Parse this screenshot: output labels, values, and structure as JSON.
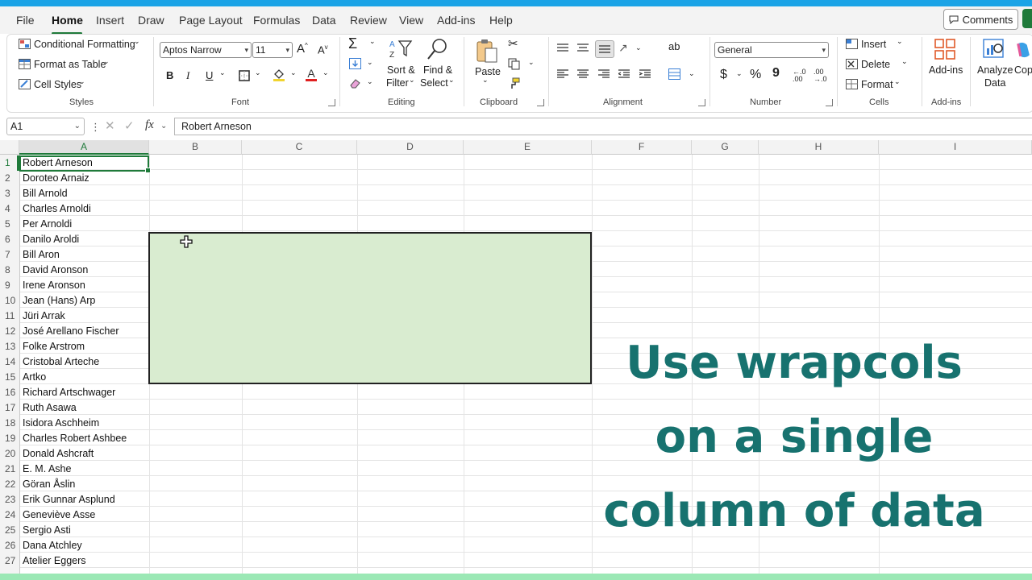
{
  "menu": {
    "tabs": [
      {
        "label": "File"
      },
      {
        "label": "Home"
      },
      {
        "label": "Insert"
      },
      {
        "label": "Draw"
      },
      {
        "label": "Page Layout"
      },
      {
        "label": "Formulas"
      },
      {
        "label": "Data"
      },
      {
        "label": "Review"
      },
      {
        "label": "View"
      },
      {
        "label": "Add-ins"
      },
      {
        "label": "Help"
      }
    ],
    "comments_label": "Comments"
  },
  "ribbon": {
    "styles": {
      "conditional_formatting": "Conditional Formatting",
      "format_as_table": "Format as Table",
      "cell_styles": "Cell Styles",
      "label": "Styles"
    },
    "font": {
      "font_name": "Aptos Narrow",
      "font_size": "11",
      "bold": "B",
      "italic": "I",
      "underline": "U",
      "grow": "A",
      "shrink": "A",
      "font_color_glyph": "A",
      "label": "Font"
    },
    "editing": {
      "sort_filter_1": "Sort &",
      "sort_filter_2": "Filter",
      "find_select_1": "Find &",
      "find_select_2": "Select",
      "label": "Editing"
    },
    "clipboard": {
      "paste": "Paste",
      "label": "Clipboard"
    },
    "alignment": {
      "label": "Alignment"
    },
    "number": {
      "format": "General",
      "label": "Number",
      "currency": "$",
      "percent": "%",
      "comma": "9"
    },
    "cells": {
      "insert": "Insert",
      "delete": "Delete",
      "format": "Format",
      "label": "Cells"
    },
    "addins": {
      "addins": "Add-ins",
      "label": "Add-ins"
    },
    "analyze": {
      "line1": "Analyze",
      "line2": "Data",
      "copilot": "Cop"
    }
  },
  "formula_bar": {
    "name_box": "A1",
    "fx": "fx",
    "content": "Robert Arneson"
  },
  "columns": [
    "A",
    "B",
    "C",
    "D",
    "E",
    "F",
    "G",
    "H",
    "I"
  ],
  "rows": [
    {
      "num": "1",
      "a": "Robert Arneson"
    },
    {
      "num": "2",
      "a": "Doroteo Arnaiz"
    },
    {
      "num": "3",
      "a": "Bill Arnold"
    },
    {
      "num": "4",
      "a": "Charles Arnoldi"
    },
    {
      "num": "5",
      "a": "Per Arnoldi"
    },
    {
      "num": "6",
      "a": "Danilo Aroldi"
    },
    {
      "num": "7",
      "a": "Bill Aron"
    },
    {
      "num": "8",
      "a": "David Aronson"
    },
    {
      "num": "9",
      "a": "Irene Aronson"
    },
    {
      "num": "10",
      "a": "Jean (Hans) Arp"
    },
    {
      "num": "11",
      "a": "Jüri Arrak"
    },
    {
      "num": "12",
      "a": "José Arellano Fischer"
    },
    {
      "num": "13",
      "a": "Folke Arstrom"
    },
    {
      "num": "14",
      "a": "Cristobal Arteche"
    },
    {
      "num": "15",
      "a": "Artko"
    },
    {
      "num": "16",
      "a": "Richard Artschwager"
    },
    {
      "num": "17",
      "a": "Ruth Asawa"
    },
    {
      "num": "18",
      "a": "Isidora Aschheim"
    },
    {
      "num": "19",
      "a": "Charles Robert Ashbee"
    },
    {
      "num": "20",
      "a": "Donald Ashcraft"
    },
    {
      "num": "21",
      "a": "E. M. Ashe"
    },
    {
      "num": "22",
      "a": "Göran Åslin"
    },
    {
      "num": "23",
      "a": "Erik Gunnar Asplund"
    },
    {
      "num": "24",
      "a": "Geneviève Asse"
    },
    {
      "num": "25",
      "a": "Sergio Asti"
    },
    {
      "num": "26",
      "a": "Dana Atchley"
    },
    {
      "num": "27",
      "a": "Atelier Eggers"
    }
  ],
  "overlay": {
    "line1": "Use wrapcols",
    "line2": "on a single",
    "line3": "column of data"
  }
}
